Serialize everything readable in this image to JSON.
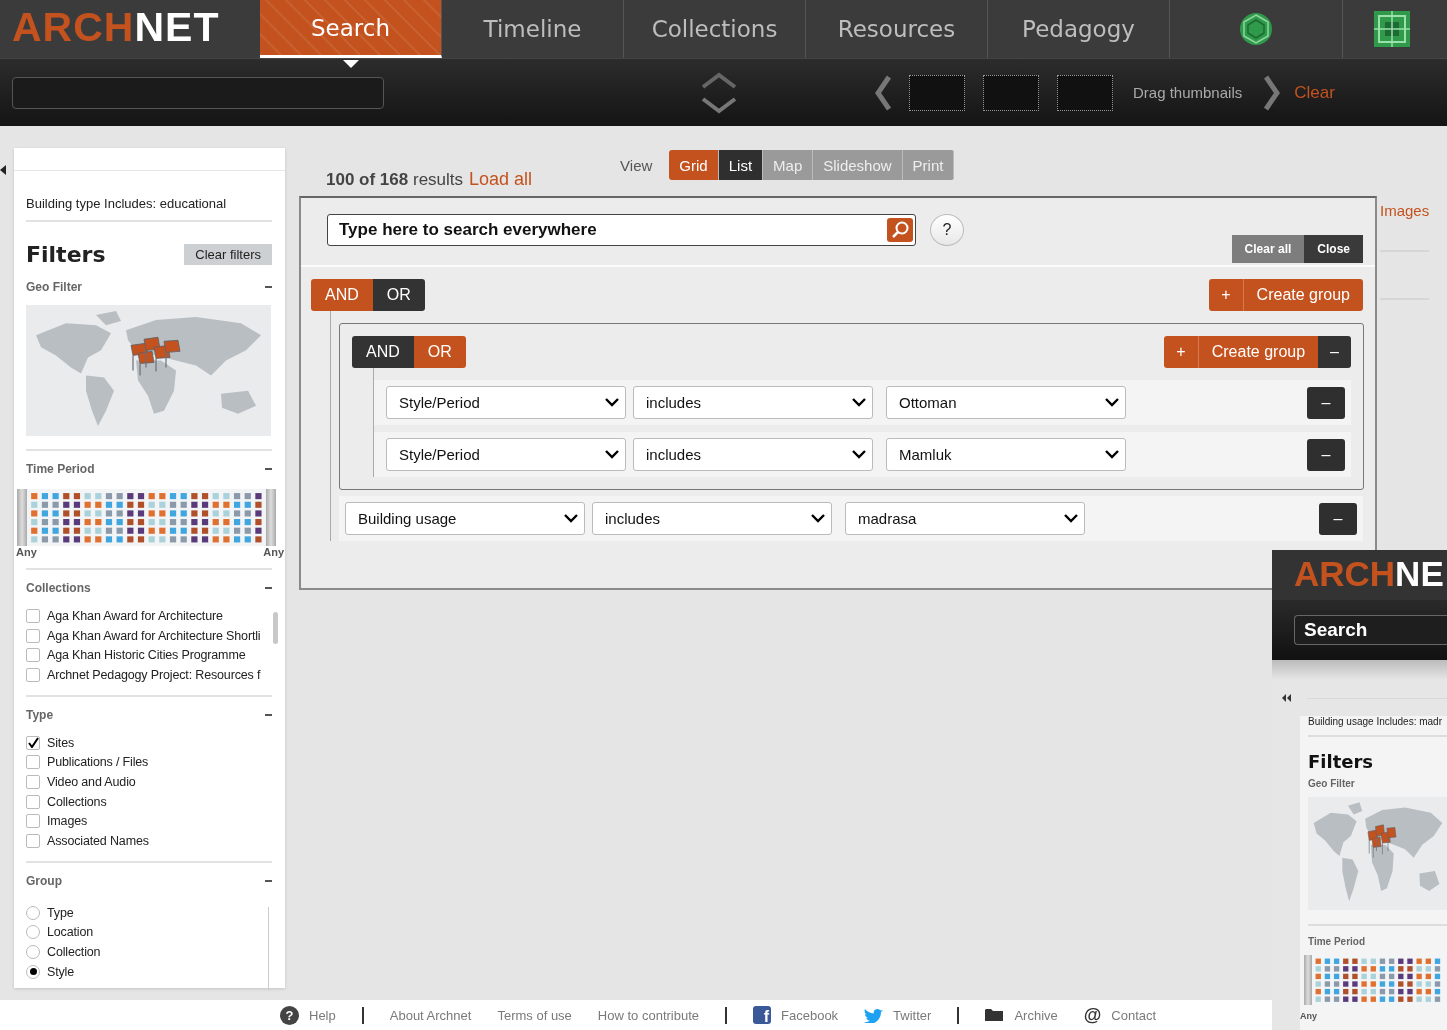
{
  "header": {
    "logo_accent": "ARCH",
    "logo_rest": "NET",
    "tabs": [
      {
        "label": "Search",
        "selected": true
      },
      {
        "label": "Timeline",
        "selected": false
      },
      {
        "label": "Collections",
        "selected": false
      },
      {
        "label": "Resources",
        "selected": false
      },
      {
        "label": "Pedagogy",
        "selected": false
      }
    ],
    "drag_hint": "Drag thumbnails",
    "clear": "Clear"
  },
  "sidebar": {
    "active_filter": "Building type Includes: educational",
    "title": "Filters",
    "clear_button": "Clear filters",
    "sections": [
      {
        "kind": "map",
        "title": "Geo Filter"
      },
      {
        "kind": "timeline",
        "title": "Time Period",
        "start_label": "Any",
        "end_label": "Any"
      },
      {
        "kind": "checkbox",
        "title": "Collections",
        "scrollable": true,
        "options": [
          {
            "label": "Aga Khan Award for Architecture",
            "checked": false
          },
          {
            "label": "Aga Khan Award for Architecture Shortli",
            "checked": false
          },
          {
            "label": "Aga Khan Historic Cities Programme",
            "checked": false
          },
          {
            "label": "Archnet Pedagogy Project: Resources f",
            "checked": false
          }
        ]
      },
      {
        "kind": "checkbox",
        "title": "Type",
        "scrollable": false,
        "options": [
          {
            "label": "Sites",
            "checked": true
          },
          {
            "label": "Publications / Files",
            "checked": false
          },
          {
            "label": "Video and Audio",
            "checked": false
          },
          {
            "label": "Collections",
            "checked": false
          },
          {
            "label": "Images",
            "checked": false
          },
          {
            "label": "Associated Names",
            "checked": false
          }
        ]
      },
      {
        "kind": "radio",
        "title": "Group",
        "scrollable": true,
        "options": [
          {
            "label": "Type",
            "selected": false
          },
          {
            "label": "Location",
            "selected": false
          },
          {
            "label": "Collection",
            "selected": false
          },
          {
            "label": "Style",
            "selected": true
          }
        ]
      }
    ]
  },
  "results": {
    "count": "100 of 168",
    "suffix": "results",
    "load_all": "Load all",
    "view_label": "View",
    "views": [
      {
        "label": "Grid",
        "selected": true,
        "highlighted": false
      },
      {
        "label": "List",
        "selected": false,
        "highlighted": true
      },
      {
        "label": "Map",
        "selected": false,
        "highlighted": false
      },
      {
        "label": "Slideshow",
        "selected": false,
        "highlighted": false
      },
      {
        "label": "Print",
        "selected": false,
        "highlighted": false
      }
    ]
  },
  "query_builder": {
    "search_placeholder": "Type here to search everywhere",
    "help": "?",
    "clear_all": "Clear all",
    "close": "Close",
    "root": {
      "conjunctions": [
        {
          "label": "AND",
          "selected": true
        },
        {
          "label": "OR",
          "selected": false
        }
      ],
      "add": "+",
      "create_group": "Create group",
      "children": [
        {
          "kind": "group",
          "conjunctions": [
            {
              "label": "AND",
              "selected": false
            },
            {
              "label": "OR",
              "selected": true
            }
          ],
          "add": "+",
          "create_group": "Create group",
          "remove": "–",
          "children": [
            {
              "kind": "rule",
              "field": "Style/Period",
              "operator": "includes",
              "value": "Ottoman",
              "remove": "–"
            },
            {
              "kind": "rule",
              "field": "Style/Period",
              "operator": "includes",
              "value": "Mamluk",
              "remove": "–"
            }
          ]
        },
        {
          "kind": "rule",
          "field": "Building usage",
          "operator": "includes",
          "value": "madrasa",
          "remove": "–"
        }
      ]
    }
  },
  "side_link": "Images",
  "embedded_screenshot": {
    "logo_accent": "ARCH",
    "logo_rest": "NE",
    "search": "Search",
    "active_filter": "Building usage Includes: madr",
    "title": "Filters",
    "geo_title": "Geo Filter",
    "time_title": "Time Period",
    "start_label": "Any"
  },
  "footer": {
    "items": [
      {
        "kind": "help",
        "symbol": "?",
        "label": "Help"
      },
      {
        "kind": "divider"
      },
      {
        "kind": "plain",
        "label": "About Archnet"
      },
      {
        "kind": "plain",
        "label": "Terms of use"
      },
      {
        "kind": "plain",
        "label": "How to contribute"
      },
      {
        "kind": "divider"
      },
      {
        "kind": "facebook",
        "symbol": "f",
        "label": "Facebook"
      },
      {
        "kind": "twitter",
        "label": "Twitter"
      },
      {
        "kind": "divider"
      },
      {
        "kind": "archive",
        "label": "Archive"
      },
      {
        "kind": "contact",
        "symbol": "@",
        "label": "Contact"
      }
    ]
  }
}
